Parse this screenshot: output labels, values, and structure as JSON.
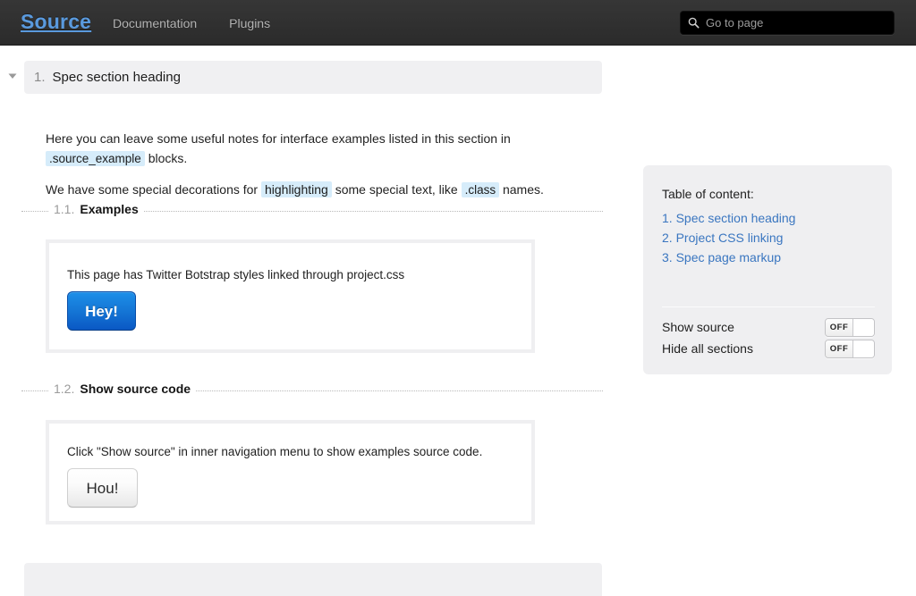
{
  "navbar": {
    "brand": "Source",
    "links": [
      {
        "label": "Documentation"
      },
      {
        "label": "Plugins"
      }
    ],
    "search": {
      "placeholder": "Go to page",
      "icon": "search-icon",
      "value": ""
    },
    "background_color": "#303030",
    "brand_color": "#5a9ade"
  },
  "sections": [
    {
      "number": "1.",
      "title": "Spec section heading",
      "collapse_icon": "triangle-down-icon",
      "paragraphs": [
        {
          "parts": [
            {
              "type": "text",
              "value": "Here you can leave some useful notes for interface examples listed in this section in "
            },
            {
              "type": "code",
              "value": ".source_example"
            },
            {
              "type": "text",
              "value": " blocks."
            }
          ]
        },
        {
          "parts": [
            {
              "type": "text",
              "value": "We have some special decorations for "
            },
            {
              "type": "highlight",
              "value": "highlighting"
            },
            {
              "type": "text",
              "value": " some special text, like "
            },
            {
              "type": "code",
              "value": ".class"
            },
            {
              "type": "text",
              "value": " names."
            }
          ]
        }
      ],
      "subsections": [
        {
          "number": "1.1.",
          "title": "Examples",
          "example": {
            "text": "This page has Twitter Botstrap styles linked through project.css",
            "button_label": "Hey!",
            "button_style": "primary"
          }
        },
        {
          "number": "1.2.",
          "title": "Show source code",
          "example": {
            "text": "Click \"Show source\" in inner navigation menu to show examples source code.",
            "button_label": "Hou!",
            "button_style": "default"
          }
        }
      ]
    }
  ],
  "toc": {
    "title": "Table of content:",
    "items": [
      {
        "label": "1. Spec section heading"
      },
      {
        "label": "2. Project CSS linking"
      },
      {
        "label": "3. Spec page markup"
      }
    ],
    "link_color": "#3a76c0",
    "toggles": [
      {
        "label": "Show source",
        "state": "OFF"
      },
      {
        "label": "Hide all sections",
        "state": "OFF"
      }
    ]
  }
}
